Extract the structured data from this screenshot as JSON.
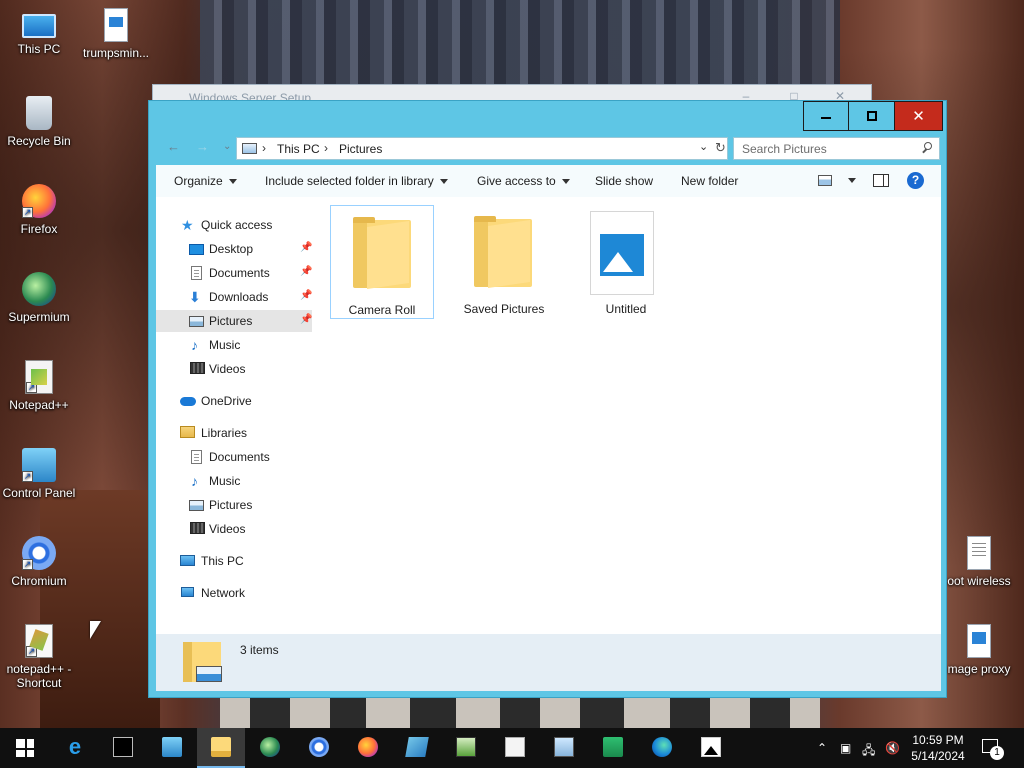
{
  "desktop": {
    "icons": [
      {
        "label": "This PC",
        "icon": "computer-icon"
      },
      {
        "label": "trumpsmin...",
        "icon": "image-file-icon"
      },
      {
        "label": "Recycle Bin",
        "icon": "recycle-bin-icon"
      },
      {
        "label": "Firefox",
        "icon": "firefox-icon"
      },
      {
        "label": "Supermium",
        "icon": "supermium-icon"
      },
      {
        "label": "Notepad++",
        "icon": "notepad-plus-plus-icon"
      },
      {
        "label": "Control Panel",
        "icon": "control-panel-icon"
      },
      {
        "label": "Chromium",
        "icon": "chromium-icon"
      },
      {
        "label": "notepad++ - Shortcut",
        "icon": "notepad-shortcut-icon"
      },
      {
        "label": "oot wireless",
        "icon": "text-file-icon"
      },
      {
        "label": "mage proxy",
        "icon": "image-file-icon"
      }
    ]
  },
  "background_window": {
    "title": "Windows Server Setup"
  },
  "explorer": {
    "window_controls": {
      "minimize": "–",
      "maximize": "□",
      "close": "✕"
    },
    "address": {
      "crumbs": [
        "This PC",
        "Pictures"
      ]
    },
    "search": {
      "placeholder": "Search Pictures"
    },
    "commands": {
      "organize": "Organize",
      "include": "Include selected folder in library",
      "give_access": "Give access to",
      "slide_show": "Slide show",
      "new_folder": "New folder",
      "help": "?"
    },
    "nav": {
      "quick_access": "Quick access",
      "quick_items": [
        {
          "label": "Desktop",
          "pinned": true
        },
        {
          "label": "Documents",
          "pinned": true
        },
        {
          "label": "Downloads",
          "pinned": true
        },
        {
          "label": "Pictures",
          "pinned": true,
          "selected": true
        },
        {
          "label": "Music",
          "pinned": false
        },
        {
          "label": "Videos",
          "pinned": false
        }
      ],
      "onedrive": "OneDrive",
      "libraries": "Libraries",
      "library_items": [
        "Documents",
        "Music",
        "Pictures",
        "Videos"
      ],
      "this_pc": "This PC",
      "network": "Network"
    },
    "items": [
      {
        "label": "Camera Roll",
        "type": "folder",
        "selected": true
      },
      {
        "label": "Saved Pictures",
        "type": "folder",
        "selected": false
      },
      {
        "label": "Untitled",
        "type": "image",
        "selected": false
      }
    ],
    "status": {
      "count": "3 items"
    }
  },
  "taskbar": {
    "apps": [
      {
        "name": "start",
        "icon": "windows-start-icon",
        "active": false
      },
      {
        "name": "internet-explorer",
        "icon": "internet-explorer-icon",
        "active": false
      },
      {
        "name": "command-prompt",
        "icon": "command-prompt-icon",
        "active": false
      },
      {
        "name": "control-panel",
        "icon": "control-panel-icon",
        "active": false
      },
      {
        "name": "file-explorer",
        "icon": "file-explorer-icon",
        "active": true
      },
      {
        "name": "supermium",
        "icon": "supermium-icon",
        "active": false
      },
      {
        "name": "chromium",
        "icon": "chromium-icon",
        "active": false
      },
      {
        "name": "firefox",
        "icon": "firefox-icon",
        "active": false
      },
      {
        "name": "notes",
        "icon": "notes-icon",
        "active": false
      },
      {
        "name": "task-manager",
        "icon": "task-manager-icon",
        "active": false
      },
      {
        "name": "notepad-plus-plus",
        "icon": "notepad-icon",
        "active": false
      },
      {
        "name": "remote-desktop",
        "icon": "remote-desktop-icon",
        "active": false
      },
      {
        "name": "snip",
        "icon": "snip-icon",
        "active": false
      },
      {
        "name": "edge",
        "icon": "edge-icon",
        "active": false
      },
      {
        "name": "photos",
        "icon": "photos-icon",
        "active": false
      }
    ],
    "clock": {
      "time": "10:59 PM",
      "date": "5/14/2024"
    },
    "notifications": {
      "count": "1"
    }
  }
}
